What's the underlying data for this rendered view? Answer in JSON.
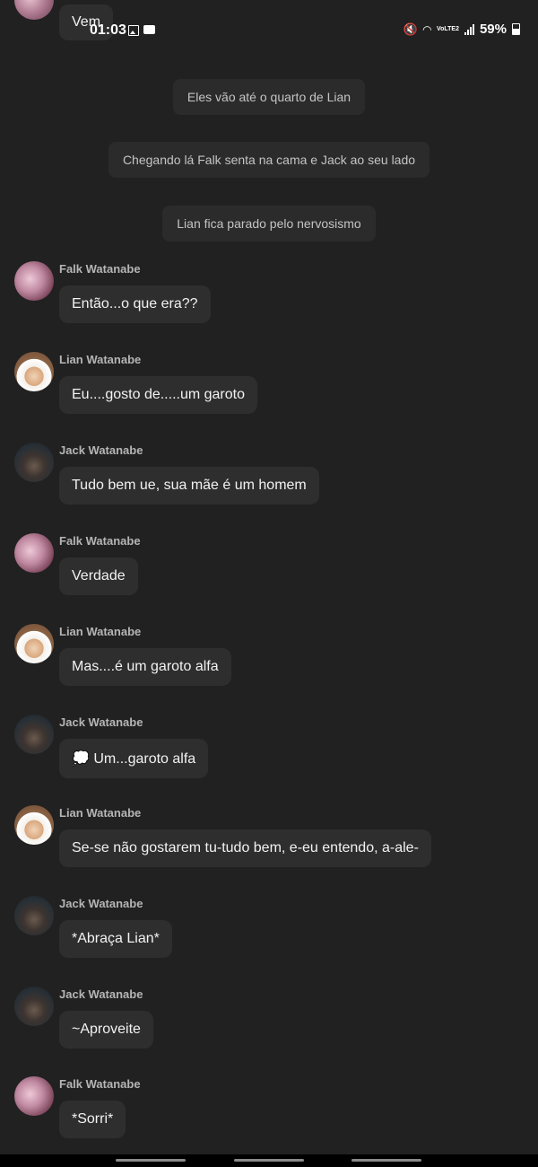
{
  "status_bar": {
    "time": "01:03",
    "battery": "59%",
    "network_label": "VoLTE2",
    "icons": [
      "image-icon",
      "notification-box-icon",
      "mute-icon",
      "wifi-icon",
      "signal-icon",
      "battery-icon"
    ]
  },
  "partial_message": {
    "text": "Vem"
  },
  "narrations": [
    "Eles vão até o quarto de Lian",
    "Chegando lá Falk senta na cama e Jack ao seu lado",
    "Lian fica parado pelo nervosismo"
  ],
  "messages": [
    {
      "sender": "Falk Watanabe",
      "text": "Então...o que era??"
    },
    {
      "sender": "Lian Watanabe",
      "text": "Eu....gosto de.....um garoto"
    },
    {
      "sender": "Jack Watanabe",
      "text": "Tudo bem ue, sua mãe é um homem"
    },
    {
      "sender": "Falk Watanabe",
      "text": "Verdade"
    },
    {
      "sender": "Lian Watanabe",
      "text": "Mas....é um garoto alfa"
    },
    {
      "sender": "Jack Watanabe",
      "text": "💭 Um...garoto alfa"
    },
    {
      "sender": "Lian Watanabe",
      "text": "Se-se não gostarem tu-tudo bem, e-eu entendo, a-ale-"
    },
    {
      "sender": "Jack Watanabe",
      "text": "*Abraça Lian*"
    },
    {
      "sender": "Jack Watanabe",
      "text": "~Aproveite"
    },
    {
      "sender": "Falk Watanabe",
      "text": "*Sorri*"
    }
  ],
  "colors": {
    "background": "#212121",
    "bubble": "#2e2e2e",
    "narration": "#2b2b2b",
    "sender_name": "#b5b5b5"
  }
}
